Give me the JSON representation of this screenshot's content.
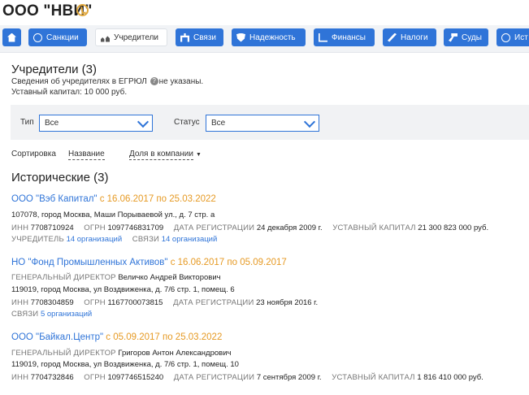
{
  "header": {
    "company_name": "ООО \"НВИ\""
  },
  "tabs": [
    {
      "label": "",
      "icon": "home-icon"
    },
    {
      "label": "Санкции",
      "icon": "globe-icon"
    },
    {
      "label": "Учредители",
      "icon": "users-icon",
      "active": true
    },
    {
      "label": "Связи",
      "icon": "links-icon"
    },
    {
      "label": "Надежность",
      "icon": "shield-icon"
    },
    {
      "label": "Финансы",
      "icon": "chart-icon"
    },
    {
      "label": "Налоги",
      "icon": "percent-icon"
    },
    {
      "label": "Суды",
      "icon": "hammer-icon"
    },
    {
      "label": "Ист",
      "icon": "history-icon"
    }
  ],
  "section": {
    "title": "Учредители (3)",
    "egrul_before": "Сведения об учредителях в ЕГРЮЛ",
    "egrul_help": "?",
    "egrul_after": "не указаны.",
    "capital": "Уставный капитал: 10 000 руб."
  },
  "filters": {
    "type_label": "Тип",
    "type_value": "Все",
    "status_label": "Статус",
    "status_value": "Все"
  },
  "sort": {
    "label": "Сортировка",
    "by_name": "Название",
    "by_share": "Доля в компании"
  },
  "historic": {
    "title": "Исторические (3)",
    "entries": [
      {
        "name": "ООО \"Вэб Капитал\"",
        "period": "с 16.06.2017 по 25.03.2022",
        "address": "107078, город Москва, Маши Порываевой ул., д. 7 стр. а",
        "inn_label": "ИНН",
        "inn": "7708710924",
        "ogrn_label": "ОГРН",
        "ogrn": "1097746831709",
        "reg_label": "ДАТА РЕГИСТРАЦИИ",
        "reg": "24 декабря 2009 г.",
        "capital_label": "УСТАВНЫЙ КАПИТАЛ",
        "capital": "21 300 823 000 руб.",
        "founder_label": "УЧРЕДИТЕЛЬ",
        "founder_link": "14 организаций",
        "links_label": "СВЯЗИ",
        "links_link": "14 организаций"
      },
      {
        "name": "НО \"Фонд Промышленных Активов\"",
        "period": "с 16.06.2017 по 05.09.2017",
        "director_label": "ГЕНЕРАЛЬНЫЙ ДИРЕКТОР",
        "director": "Величко Андрей Викторович",
        "address": "119019, город Москва, ул Воздвиженка, д. 7/6 стр. 1, помещ. 6",
        "inn_label": "ИНН",
        "inn": "7708304859",
        "ogrn_label": "ОГРН",
        "ogrn": "1167700073815",
        "reg_label": "ДАТА РЕГИСТРАЦИИ",
        "reg": "23 ноября 2016 г.",
        "links_label": "СВЯЗИ",
        "links_link": "5 организаций"
      },
      {
        "name": "ООО \"Байкал.Центр\"",
        "period": "с 05.09.2017 по 25.03.2022",
        "director_label": "ГЕНЕРАЛЬНЫЙ ДИРЕКТОР",
        "director": "Григоров Антон Александрович",
        "address": "119019, город Москва, ул Воздвиженка, д. 7/6 стр. 1, помещ. 10",
        "inn_label": "ИНН",
        "inn": "7704732846",
        "ogrn_label": "ОГРН",
        "ogrn": "1097746515240",
        "reg_label": "ДАТА РЕГИСТРАЦИИ",
        "reg": "7 сентября 2009 г.",
        "capital_label": "УСТАВНЫЙ КАПИТАЛ",
        "capital": "1 816 410 000 руб."
      }
    ]
  },
  "colors": {
    "accent": "#2f74d8",
    "period": "#e69a24",
    "status": "#e0a63a"
  }
}
